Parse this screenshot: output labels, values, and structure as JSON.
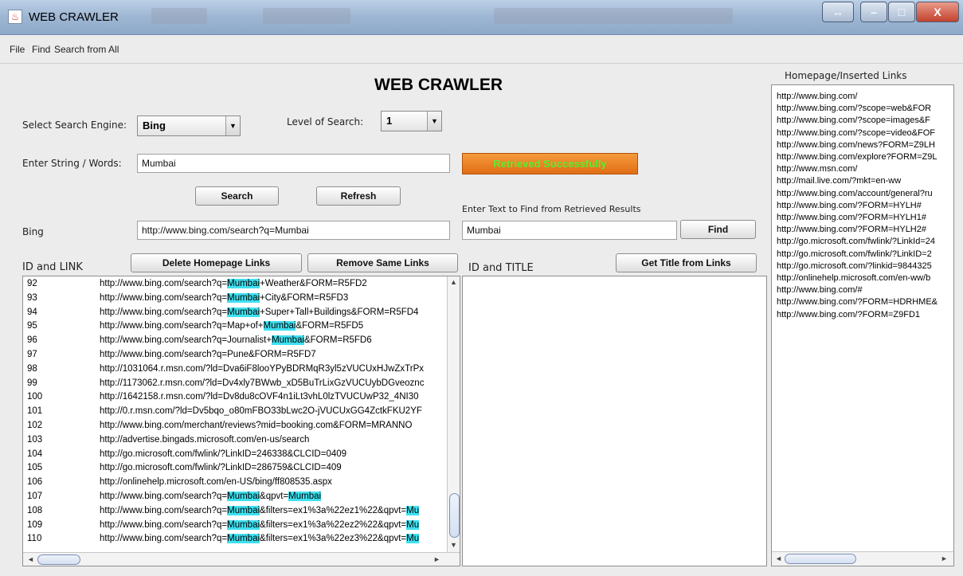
{
  "window": {
    "title": "WEB CRAWLER",
    "app_icon": "java-cup-icon",
    "restore_label": "↔",
    "min_label": "–",
    "max_label": "□",
    "close_label": "X"
  },
  "menu": {
    "items": [
      "File",
      "Find",
      "Search from All"
    ]
  },
  "heading": "WEB CRAWLER",
  "form": {
    "engine_label": "Select Search Engine:",
    "engine_value": "Bing",
    "level_label": "Level of Search:",
    "level_value": "1",
    "string_label": "Enter String / Words:",
    "string_value": "Mumbai",
    "status": "Retrieved Successfully",
    "search_btn": "Search",
    "refresh_btn": "Refresh",
    "find_label": "Enter Text to Find from Retrieved Results",
    "engine_name": "Bing",
    "url_value": "http://www.bing.com/search?q=Mumbai",
    "find_value": "Mumbai",
    "find_btn": "Find"
  },
  "left_panel": {
    "header": "ID and LINK",
    "delete_btn": "Delete Homepage Links",
    "remove_btn": "Remove Same Links",
    "rows": [
      {
        "id": "92",
        "pre": "http://www.bing.com/search?q=",
        "hl": "Mumbai",
        "post": "+Weather&FORM=R5FD2"
      },
      {
        "id": "93",
        "pre": "http://www.bing.com/search?q=",
        "hl": "Mumbai",
        "post": "+City&FORM=R5FD3"
      },
      {
        "id": "94",
        "pre": "http://www.bing.com/search?q=",
        "hl": "Mumbai",
        "post": "+Super+Tall+Buildings&FORM=R5FD4"
      },
      {
        "id": "95",
        "pre": "http://www.bing.com/search?q=Map+of+",
        "hl": "Mumbai",
        "post": "&FORM=R5FD5"
      },
      {
        "id": "96",
        "pre": "http://www.bing.com/search?q=Journalist+",
        "hl": "Mumbai",
        "post": "&FORM=R5FD6"
      },
      {
        "id": "97",
        "pre": "http://www.bing.com/search?q=Pune&FORM=R5FD7",
        "hl": "",
        "post": ""
      },
      {
        "id": "98",
        "pre": "http://1031064.r.msn.com/?ld=Dva6iF8looYPyBDRMqR3yl5zVUCUxHJwZxTrPx",
        "hl": "",
        "post": ""
      },
      {
        "id": "99",
        "pre": "http://1173062.r.msn.com/?ld=Dv4xly7BWwb_xD5BuTrLixGzVUCUybDGveoznc",
        "hl": "",
        "post": ""
      },
      {
        "id": "100",
        "pre": "http://1642158.r.msn.com/?ld=Dv8du8cOVF4n1iLt3vhL0lzTVUCUwP32_4NI30",
        "hl": "",
        "post": ""
      },
      {
        "id": "101",
        "pre": "http://0.r.msn.com/?ld=Dv5bqo_o80mFBO33bLwc2O-jVUCUxGG4ZctkFKU2YF",
        "hl": "",
        "post": ""
      },
      {
        "id": "102",
        "pre": "http://www.bing.com/merchant/reviews?mid=booking.com&FORM=MRANNO",
        "hl": "",
        "post": ""
      },
      {
        "id": "103",
        "pre": "http://advertise.bingads.microsoft.com/en-us/search",
        "hl": "",
        "post": ""
      },
      {
        "id": "104",
        "pre": "http://go.microsoft.com/fwlink/?LinkID=246338&CLCID=0409",
        "hl": "",
        "post": ""
      },
      {
        "id": "105",
        "pre": "http://go.microsoft.com/fwlink/?LinkID=286759&CLCID=409",
        "hl": "",
        "post": ""
      },
      {
        "id": "106",
        "pre": "http://onlinehelp.microsoft.com/en-US/bing/ff808535.aspx",
        "hl": "",
        "post": ""
      },
      {
        "id": "107",
        "pre": "http://www.bing.com/search?q=",
        "hl": "Mumbai",
        "post": "&qpvt=",
        "hl2": "Mumbai"
      },
      {
        "id": "108",
        "pre": "http://www.bing.com/search?q=",
        "hl": "Mumbai",
        "post": "&filters=ex1%3a%22ez1%22&qpvt=",
        "hl2": "Mu"
      },
      {
        "id": "109",
        "pre": "http://www.bing.com/search?q=",
        "hl": "Mumbai",
        "post": "&filters=ex1%3a%22ez2%22&qpvt=",
        "hl2": "Mu"
      },
      {
        "id": "110",
        "pre": "http://www.bing.com/search?q=",
        "hl": "Mumbai",
        "post": "&filters=ex1%3a%22ez3%22&qpvt=",
        "hl2": "Mu"
      }
    ]
  },
  "middle_panel": {
    "header": "ID and TITLE",
    "get_title_btn": "Get Title from Links"
  },
  "right_panel": {
    "header": "Homepage/Inserted Links",
    "links": [
      "http://www.bing.com/",
      "http://www.bing.com/?scope=web&FOR",
      "http://www.bing.com/?scope=images&F",
      "http://www.bing.com/?scope=video&FOF",
      "http://www.bing.com/news?FORM=Z9LH",
      "http://www.bing.com/explore?FORM=Z9L",
      "http://www.msn.com/",
      "http://mail.live.com/?mkt=en-ww",
      "http://www.bing.com/account/general?ru",
      "http://www.bing.com/?FORM=HYLH#",
      "http://www.bing.com/?FORM=HYLH1#",
      "http://www.bing.com/?FORM=HYLH2#",
      "http://go.microsoft.com/fwlink/?LinkId=24",
      "http://go.microsoft.com/fwlink/?LinkID=2",
      "http://go.microsoft.com/?linkid=9844325",
      "http://onlinehelp.microsoft.com/en-ww/b",
      "http://www.bing.com/#",
      "http://www.bing.com/?FORM=HDRHME&",
      "http://www.bing.com/?FORM=Z9FD1"
    ]
  }
}
